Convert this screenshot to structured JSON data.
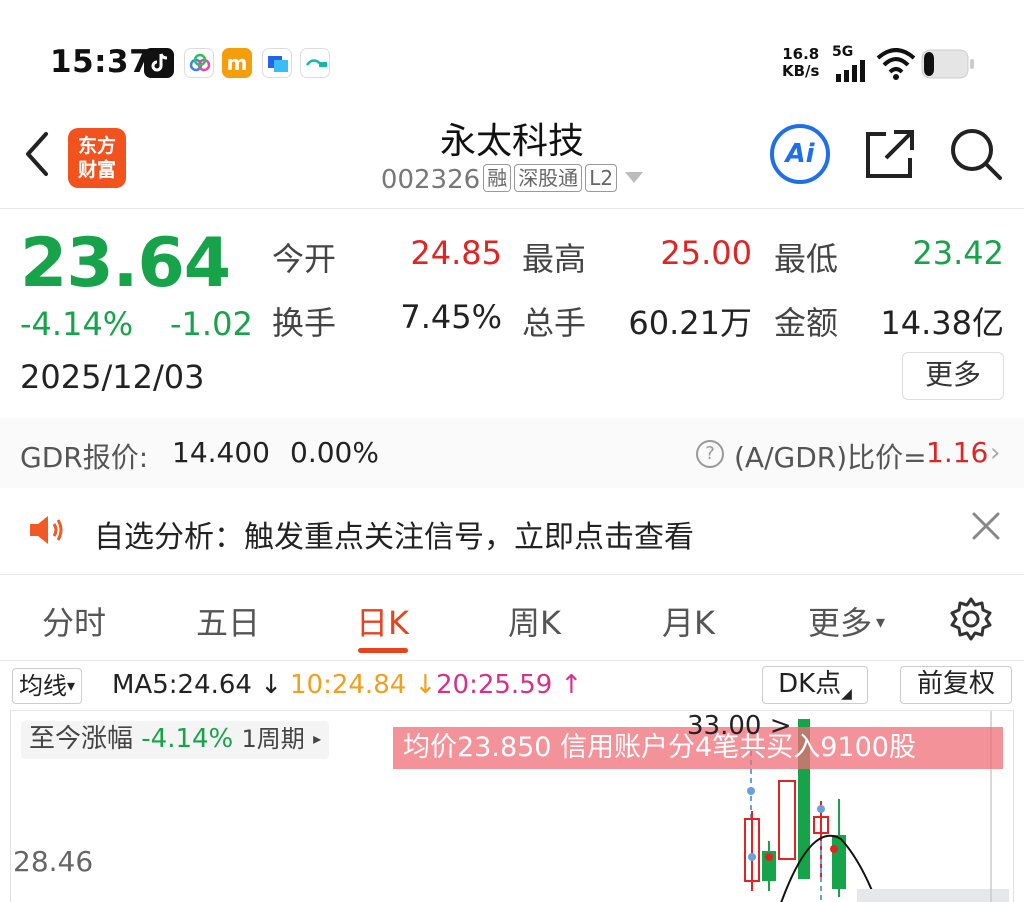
{
  "status_bar": {
    "time": "15:37",
    "net_speed_value": "16.8",
    "net_speed_unit": "KB/s",
    "network": "5G",
    "icons": [
      "tiktok-icon",
      "cloud-icon",
      "m-app-icon",
      "chat-app-icon",
      "pay-app-icon",
      "signal-icon",
      "wifi-icon",
      "battery-icon"
    ]
  },
  "header": {
    "logo_line1": "东方",
    "logo_line2": "财富",
    "stock_name": "永太科技",
    "stock_code": "002326",
    "tags": [
      "融",
      "深股通",
      "L2"
    ],
    "ai_label": "Ai"
  },
  "quote": {
    "price": "23.64",
    "change_pct": "-4.14%",
    "change": "-1.02",
    "date": "2025/12/03",
    "open_label": "今开",
    "open_value": "24.85",
    "high_label": "最高",
    "high_value": "25.00",
    "low_label": "最低",
    "low_value": "23.42",
    "turnover_label": "换手",
    "turnover_value": "7.45%",
    "volume_label": "总手",
    "volume_value": "60.21万",
    "amount_label": "金额",
    "amount_value": "14.38亿",
    "more_label": "更多"
  },
  "gdr": {
    "label": "GDR报价:",
    "value": "14.400",
    "pct": "0.00%",
    "ratio_label": "(A/GDR)比价=",
    "ratio_value": "1.16"
  },
  "notice": {
    "text": "自选分析：触发重点关注信号，立即点击查看"
  },
  "tabs": [
    {
      "label": "分时"
    },
    {
      "label": "五日"
    },
    {
      "label": "日K"
    },
    {
      "label": "周K"
    },
    {
      "label": "月K"
    },
    {
      "label": "更多"
    }
  ],
  "ma_row": {
    "selector": "均线",
    "ma5": "MA5:24.64",
    "ma10": "10:24.84",
    "ma20": "20:25.59",
    "dk_label": "DK点",
    "adjust_label": "前复权"
  },
  "chart": {
    "period_label": "至今涨幅",
    "period_value": "-4.14%",
    "period_cycle": "1周期",
    "banner_text": "均价23.850  信用账户分4笔共买入9100股",
    "high_marker": "33.00",
    "y_tick": "28.46"
  },
  "colors": {
    "up": "#e02424",
    "down": "#16a34a",
    "accent": "#e8431c",
    "ai_blue": "#1e6fe8",
    "ma10": "#f0a020",
    "ma20": "#d6308a"
  }
}
